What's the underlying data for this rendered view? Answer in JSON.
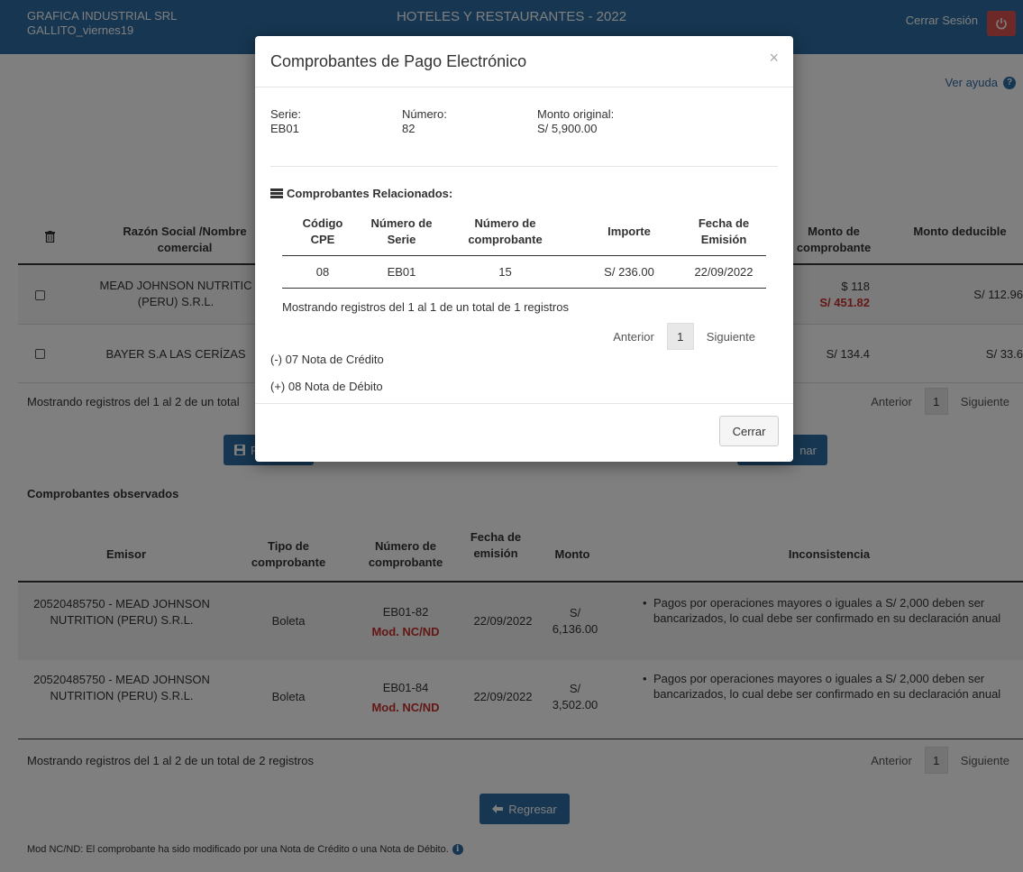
{
  "header": {
    "company": "GRAFICA INDUSTRIAL SRL",
    "user": "GALLITO_viernes19",
    "title": "HOTELES Y RESTAURANTES - 2022",
    "logout_label": "Cerrar Sesión",
    "power_icon": "power-icon"
  },
  "help_label": "Ver ayuda",
  "main_table": {
    "headers": {
      "razon_social": "Razón Social /Nombre comercial",
      "monto_comprobante": "Monto de comprobante",
      "monto_deducible": "Monto deducible"
    },
    "rows": [
      {
        "razon_social": "MEAD JOHNSON NUTRITIC (PERU) S.R.L.",
        "monto": "$ 118",
        "monto_red": "S/ 451.82",
        "deducible": "S/ 112.96"
      },
      {
        "razon_social": "BAYER S.A LAS CERÍZAS",
        "monto": "S/ 134.4",
        "deducible": "S/ 33.6"
      }
    ],
    "pager_text": "Mostrando registros del 1 al 2 de un total",
    "pager_prev": "Anterior",
    "pager_page": "1",
    "pager_next": "Siguiente"
  },
  "buttons": {
    "save_partial": "F",
    "right_partial": "nar"
  },
  "observados": {
    "title": "Comprobantes observados",
    "headers": {
      "emisor": "Emisor",
      "tipo": "Tipo de comprobante",
      "numero": "Número de comprobante",
      "fecha": "Fecha de emisión",
      "monto": "Monto",
      "inconsistencia": "Inconsistencia"
    },
    "rows": [
      {
        "emisor": "20520485750 - MEAD JOHNSON NUTRITION (PERU) S.R.L.",
        "tipo": "Boleta",
        "numero": "EB01-82",
        "mod": "Mod. NC/ND",
        "fecha": "22/09/2022",
        "monto": "S/ 6,136.00",
        "inconsistencia": "Pagos por operaciones mayores o iguales a S/ 2,000 deben ser bancarizados, lo cual debe ser confirmado en su declaración anual"
      },
      {
        "emisor": "20520485750 - MEAD JOHNSON NUTRITION (PERU) S.R.L.",
        "tipo": "Boleta",
        "numero": "EB01-84",
        "mod": "Mod. NC/ND",
        "fecha": "22/09/2022",
        "monto": "S/ 3,502.00",
        "inconsistencia": "Pagos por operaciones mayores o iguales a S/ 2,000 deben ser bancarizados, lo cual debe ser confirmado en su declaración anual"
      }
    ],
    "pager_text": "Mostrando registros del 1 al 2 de un total de 2 registros",
    "pager_prev": "Anterior",
    "pager_page": "1",
    "pager_next": "Siguiente"
  },
  "back_button": "Regresar",
  "footnote": "Mod NC/ND: El comprobante ha sido modificado por una Nota de Crédito o una Nota de Débito.",
  "modal": {
    "title": "Comprobantes de Pago Electrónico",
    "close_symbol": "×",
    "serie_label": "Serie:",
    "serie_value": "EB01",
    "numero_label": "Número:",
    "numero_value": "82",
    "monto_label": "Monto original:",
    "monto_value": "S/ 5,900.00",
    "related_title": "Comprobantes Relacionados:",
    "table_headers": {
      "codigo": "Código CPE",
      "serie": "Número de Serie",
      "numero": "Número de comprobante",
      "importe": "Importe",
      "fecha": "Fecha de Emisión"
    },
    "row": {
      "codigo": "08",
      "serie": "EB01",
      "numero": "15",
      "importe": "S/ 236.00",
      "fecha": "22/09/2022"
    },
    "pager_text": "Mostrando registros del 1 al 1 de un total de 1 registros",
    "pager_prev": "Anterior",
    "pager_page": "1",
    "pager_next": "Siguiente",
    "legend_nc": "(-) 07 Nota de Crédito",
    "legend_nd": "(+) 08 Nota de Débito",
    "close_button": "Cerrar"
  },
  "colors": {
    "header_blue": "#2d6ca2",
    "danger_red": "#c9302c",
    "power_red": "#d9534f"
  }
}
